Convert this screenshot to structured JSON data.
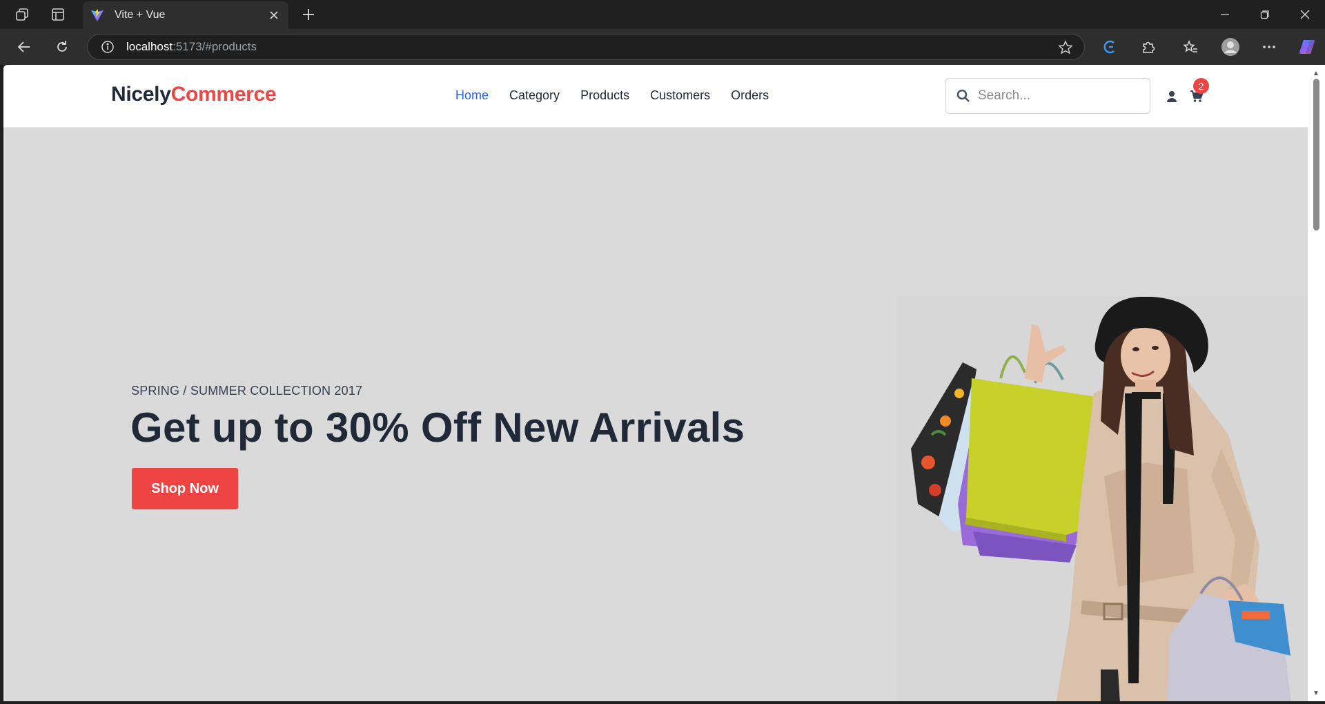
{
  "browser": {
    "tab_title": "Vite + Vue",
    "url_host": "localhost",
    "url_rest": ":5173/#products"
  },
  "site": {
    "logo_part1": "Nicely",
    "logo_part2": "Commerce",
    "nav": [
      {
        "label": "Home",
        "active": true
      },
      {
        "label": "Category",
        "active": false
      },
      {
        "label": "Products",
        "active": false
      },
      {
        "label": "Customers",
        "active": false
      },
      {
        "label": "Orders",
        "active": false
      }
    ],
    "search_placeholder": "Search...",
    "cart_count": "2"
  },
  "hero": {
    "subtitle": "SPRING / SUMMER COLLECTION 2017",
    "title": "Get up to 30% Off New Arrivals",
    "button_label": "Shop Now"
  },
  "colors": {
    "accent_red": "#ef4444",
    "active_link": "#2563eb",
    "hero_bg": "#dadada"
  }
}
